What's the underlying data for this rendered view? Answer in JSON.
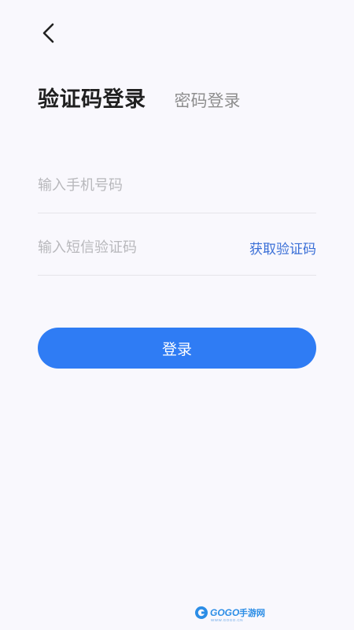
{
  "nav": {
    "back_icon": "chevron-left-icon"
  },
  "tabs": {
    "active": "验证码登录",
    "inactive": "密码登录"
  },
  "form": {
    "phone_placeholder": "输入手机号码",
    "code_placeholder": "输入短信验证码",
    "get_code_label": "获取验证码",
    "login_label": "登录"
  },
  "watermark": {
    "text": "GOGO手游网",
    "subtext": "WWW.GOGO.CN"
  },
  "colors": {
    "background": "#f9f8fd",
    "primary": "#2f7cf4",
    "link": "#3a6fd7",
    "divider": "#e6e4ea"
  }
}
